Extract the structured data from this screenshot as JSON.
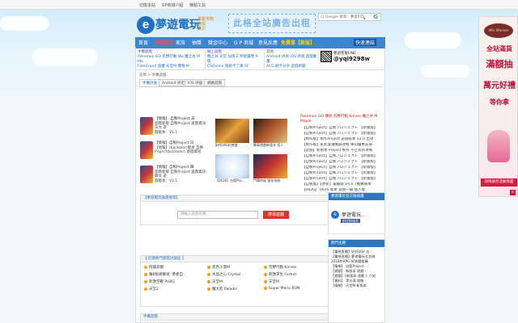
{
  "topbar": {
    "links": [
      "切換本站",
      "GP商城介紹",
      "賺點工具"
    ]
  },
  "header": {
    "logo_name": "夢遊電玩",
    "logo_tags": [
      "專業攻略",
      "遊戲",
      "資訊"
    ],
    "ad_text": "此格全站廣告出租",
    "search_placeholder": "以 Google 搜尋：夢遊電玩",
    "search_icon": "search-icon",
    "google_icon": "google-icon"
  },
  "nav": {
    "items": [
      "首頁",
      "詳細資料",
      "家族",
      "抽獎",
      "獎金中心",
      "G P 商城",
      "意見反應",
      "免費拿【新版】"
    ],
    "dropdown": "快速連結"
  },
  "subnav": {
    "col1_head": "手機遊戲",
    "col1_lines": [
      "Pokemon GO 荒野行動 Wa 魔之谷 M Ma",
      "FateGrand 旅機 天堂M 寶物 M"
    ],
    "col2_head": "線上遊戲",
    "col2_lines": [
      "楓之谷 天堂 仙境 Z 明星露營 R 開",
      "CSOnline 跑跑卡丁車 SF"
    ],
    "col3_head": "其他",
    "col3_lines": [
      "Android 評測 iOS 評測 遊戲動畫",
      "ACG 刷卡分享 遊戲新聞"
    ],
    "line_title": "夢遊客服LINE",
    "line_id": "@yqi9298w"
  },
  "breadcrumb": "首頁 > 手機遊戲",
  "tabs": [
    "手機討論",
    "Android 評定",
    "IOS 評論",
    "網路遊戲"
  ],
  "news": [
    {
      "title": "【情報】 自製Project 日",
      "lines": [
        "遊戲新版 自製Project 遊戲資訊：日文 遊",
        "戲版本：V1.1"
      ]
    },
    {
      "title": "【情報】自製Project 日",
      "lines": [
        "遊戲新版 自製Project 遊戲資訊：日文 遊",
        "戲版本：V1.1"
      ]
    },
    {
      "title": "【情報】自製Project 日",
      "lines": [
        "【情報】(backolor)版本 自製",
        "Project(backolor) 遊戲資訊"
      ]
    },
    {
      "title": "【情報】自製Project 韓",
      "lines": [
        "遊戲新版 自製Project 遊戲資訊：韓文 遊",
        "戲版本：V1.1"
      ]
    }
  ],
  "pics": [
    {
      "caption": "取得360好感度"
    },
    {
      "caption": "賽車遊戲新版本 用人"
    },
    {
      "caption": "【0626】台版Pro..."
    },
    {
      "caption": "鬥陣特攻 強化系統"
    }
  ],
  "hot": {
    "head": "Pokemon GO 傳說 荒野行動 Knives 魔之谷 M Maple",
    "rows": [
      "【自製Project】自製プロジェクト 【新版版】",
      "【自製Project】自製プロジェクト 【新版版】",
      "【製作版】製作Project 遊戲版本 V2.0 出現",
      "【製作版】貳貳會議機器攻略 事前優惠註冊",
      "【遊戲】新版本 Project 製作 不止有新攻略",
      "【自製Project】自製プロジェクト 【新版版】",
      "【自製Project】自製プロジェクト 【新版版】",
      "【自製Project】自製プロジェクト 【新版版】",
      "【自製Project】自製プロジェクト 【新版版】",
      "【自製Project】自製プロジェクト 【新版版】",
      "【自製版】【更新】電腦版 V4.0.7推薦版本",
      "【0626】 0626 版本 遊戲一級 個人版"
    ]
  },
  "search2": {
    "head": "【夢遊電玩論壇搜尋】",
    "placeholder": "請輸入遊戲名稱...",
    "button": "搜尋遊戲"
  },
  "games": {
    "head": "【 近期熱門遊戲討論區 】",
    "cols": [
      [
        "阿龍高爾",
        "陳B魚德魯瑞 ·勇者自",
        "刺激空戰 PUBG",
        "天堂M"
      ],
      [
        "黑色沙漠M",
        "水晶之心 Crystal",
        "天堂M",
        "精大勇者"
      ],
      [
        "荒野行動 Knives",
        "刺激求生 Fortnit",
        "天堂M"
      ],
      [
        "Super Mario RUN"
      ]
    ]
  },
  "games_extra": {
    "col1_last": "天堂2",
    "col2_last": "魔大陸 Paladin"
  },
  "bottom_head": "手機遊戲",
  "right": {
    "fb_head": "夢遊電玩官方粉絲團",
    "fb_name": "夢遊電玩...",
    "fb_button": "前往粉絲頁",
    "topics_head": "熱門主題",
    "topics": [
      "【電視直播】好好好好 去  -",
      "【電視直播】夢遊電玩全台灣",
      "2018年RPG 好遊戲推薦",
      "【情報】 自製Project ...",
      "【遊戲】 新版本 遊戲 -",
      "【遊戲】《新版本 遊戲 》介紹",
      "【資料】 黑沙漠 攻略 -",
      "【情報】 天堂M 新版本"
    ]
  },
  "sidead": {
    "brand": "Win Women",
    "line1": "全站滿貨",
    "line2": "滿額抽",
    "line3": "萬元好禮",
    "line4": "等你拿",
    "ribbon": "詳情請見活動頁面",
    "close": "x"
  }
}
